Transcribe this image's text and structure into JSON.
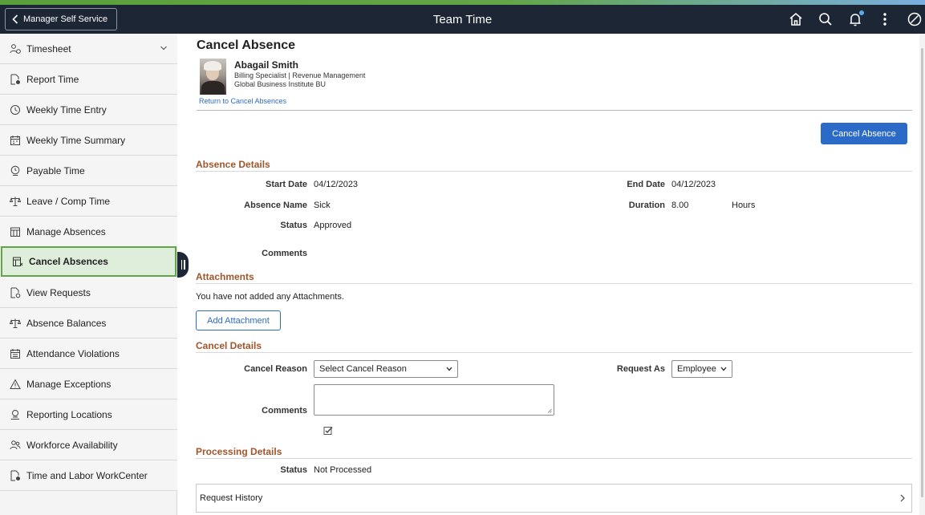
{
  "topbar": {
    "back_label": "Manager Self Service",
    "title": "Team Time",
    "icons": [
      "home-icon",
      "search-icon",
      "notifications-icon",
      "more-actions-icon",
      "navbar-icon"
    ]
  },
  "sidebar": {
    "items": [
      {
        "label": "Timesheet",
        "icon": "person-clock-icon"
      },
      {
        "label": "Report Time",
        "icon": "report-time-icon"
      },
      {
        "label": "Weekly Time Entry",
        "icon": "clock-icon"
      },
      {
        "label": "Weekly Time Summary",
        "icon": "calendar-summary-icon"
      },
      {
        "label": "Payable Time",
        "icon": "payable-time-icon"
      },
      {
        "label": "Leave / Comp Time",
        "icon": "scales-icon"
      },
      {
        "label": "Manage Absences",
        "icon": "manage-absences-icon"
      },
      {
        "label": "Cancel Absences",
        "icon": "cancel-absences-icon"
      },
      {
        "label": "View Requests",
        "icon": "view-requests-icon"
      },
      {
        "label": "Absence Balances",
        "icon": "balance-icon"
      },
      {
        "label": "Attendance Violations",
        "icon": "calendar-icon"
      },
      {
        "label": "Manage Exceptions",
        "icon": "warning-icon"
      },
      {
        "label": "Reporting Locations",
        "icon": "location-icon"
      },
      {
        "label": "Workforce Availability",
        "icon": "people-icon"
      },
      {
        "label": "Time and Labor WorkCenter",
        "icon": "workcenter-icon"
      }
    ],
    "active_index": 7
  },
  "main": {
    "title": "Cancel Absence",
    "employee": {
      "name": "Abagail Smith",
      "role": "Billing Specialist | Revenue Management",
      "business_unit": "Global Business Institute BU"
    },
    "return_link": "Return to Cancel Absences",
    "cancel_button": "Cancel Absence",
    "absence_details": {
      "title": "Absence Details",
      "start_date_label": "Start Date",
      "start_date": "04/12/2023",
      "end_date_label": "End Date",
      "end_date": "04/12/2023",
      "absence_name_label": "Absence Name",
      "absence_name": "Sick",
      "duration_label": "Duration",
      "duration": "8.00",
      "duration_unit": "Hours",
      "status_label": "Status",
      "status": "Approved",
      "comments_label": "Comments"
    },
    "attachments": {
      "title": "Attachments",
      "empty_text": "You have not added any Attachments.",
      "add_button": "Add Attachment"
    },
    "cancel_details": {
      "title": "Cancel Details",
      "reason_label": "Cancel Reason",
      "reason_value": "Select Cancel Reason",
      "request_as_label": "Request As",
      "request_as_value": "Employee",
      "comments_label": "Comments",
      "comments_value": ""
    },
    "processing_details": {
      "title": "Processing Details",
      "status_label": "Status",
      "status": "Not Processed",
      "request_history": "Request History"
    }
  },
  "colors": {
    "topbar": "#1d2635",
    "accent_green": "#62a548",
    "primary_blue": "#2c6ac8",
    "section_title": "#a0552a",
    "active_nav_bg": "#dfeedb"
  }
}
